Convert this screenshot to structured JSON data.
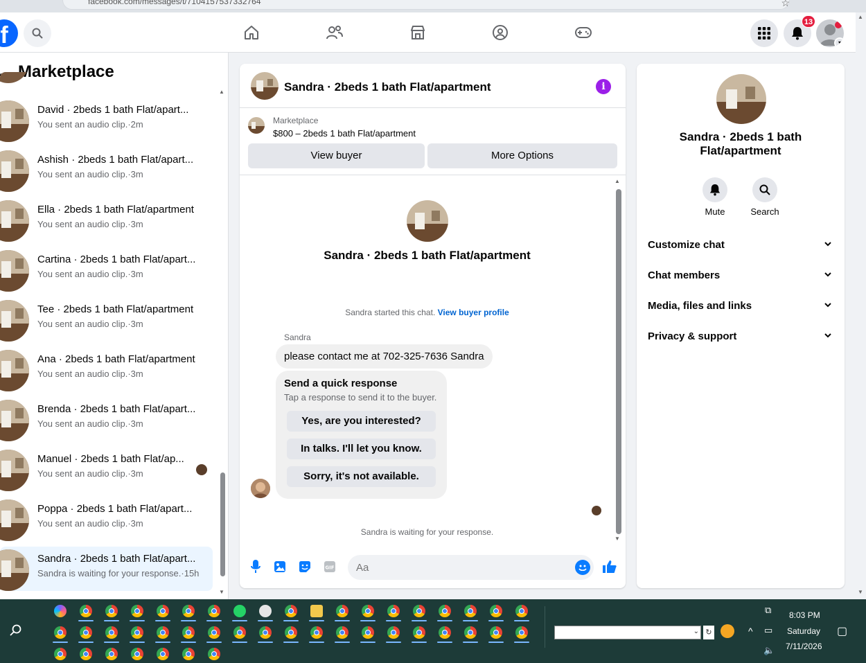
{
  "browser": {
    "url": "facebook.com/messages/t/7104157537332764"
  },
  "nav": {
    "notification_count": "13"
  },
  "sidebar": {
    "title": "Marketplace",
    "conversations": [
      {
        "name": "David · 2beds 1 bath Flat/apart...",
        "sub": "You sent an audio clip.·2m",
        "active": false
      },
      {
        "name": "Ashish · 2beds 1 bath Flat/apart...",
        "sub": "You sent an audio clip.·3m",
        "active": false
      },
      {
        "name": "Ella · 2beds 1 bath Flat/apartment",
        "sub": "You sent an audio clip.·3m",
        "active": false
      },
      {
        "name": "Cartina · 2beds 1 bath Flat/apart...",
        "sub": "You sent an audio clip.·3m",
        "active": false
      },
      {
        "name": "Tee · 2beds 1 bath Flat/apartment",
        "sub": "You sent an audio clip.·3m",
        "active": false
      },
      {
        "name": "Ana · 2beds 1 bath Flat/apartment",
        "sub": "You sent an audio clip.·3m",
        "active": false
      },
      {
        "name": "Brenda · 2beds 1 bath Flat/apart...",
        "sub": "You sent an audio clip.·3m",
        "active": false
      },
      {
        "name": "Manuel · 2beds 1 bath Flat/ap...",
        "sub": "You sent an audio clip.·3m",
        "active": false
      },
      {
        "name": "Poppa · 2beds 1 bath Flat/apart...",
        "sub": "You sent an audio clip.·3m",
        "active": false
      },
      {
        "name": "Sandra · 2beds 1 bath Flat/apart...",
        "sub": "Sandra is waiting for your response.·15h",
        "active": true
      }
    ]
  },
  "chat": {
    "title": "Sandra · 2beds 1 bath Flat/apartment",
    "listing_label": "Marketplace",
    "listing_price": "$800 – 2beds 1 bath Flat/apartment",
    "view_buyer": "View buyer",
    "more_options": "More Options",
    "intro_title": "Sandra · 2beds 1 bath Flat/apartment",
    "started_text": "Sandra started this chat.",
    "view_profile": "View buyer profile",
    "sender": "Sandra",
    "message": "please contact me at 702-325-7636 Sandra",
    "quick_title": "Send a quick response",
    "quick_sub": "Tap a response to send it to the buyer.",
    "quick_replies": [
      "Yes, are you interested?",
      "In talks. I'll let you know.",
      "Sorry, it's not available."
    ],
    "waiting": "Sandra is waiting for your response.",
    "input_placeholder": "Aa"
  },
  "info": {
    "title": "Sandra · 2beds 1 bath Flat/apartment",
    "mute": "Mute",
    "search": "Search",
    "rows": [
      "Customize chat",
      "Chat members",
      "Media, files and links",
      "Privacy & support"
    ]
  },
  "taskbar": {
    "time": "8:03 PM",
    "day": "Saturday",
    "date": "7/11/2026"
  }
}
